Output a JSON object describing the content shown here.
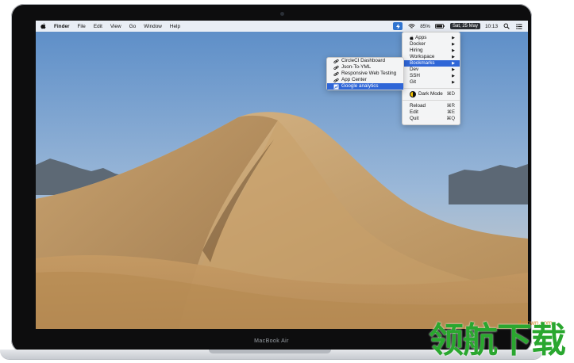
{
  "menubar": {
    "items": [
      {
        "label": "Finder",
        "bold": true
      },
      {
        "label": "File"
      },
      {
        "label": "Edit"
      },
      {
        "label": "View"
      },
      {
        "label": "Go"
      },
      {
        "label": "Window"
      },
      {
        "label": "Help"
      }
    ],
    "battery": "85%",
    "date": "Sat, 25 May",
    "time": "10:13"
  },
  "menu": {
    "items": [
      {
        "label": "Apps",
        "submenu": true
      },
      {
        "label": "Docker",
        "submenu": true
      },
      {
        "label": "Hiring",
        "submenu": true
      },
      {
        "label": "Workspace",
        "submenu": true
      },
      {
        "label": "Bookmarks",
        "submenu": true,
        "selected": true
      },
      {
        "label": "Dev",
        "submenu": true
      },
      {
        "label": "SSH",
        "submenu": true
      },
      {
        "label": "Git",
        "submenu": true
      }
    ],
    "dark_mode": {
      "label": "Dark Mode",
      "shortcut": "⌘D"
    },
    "bottom": [
      {
        "label": "Reload",
        "shortcut": "⌘R"
      },
      {
        "label": "Edit",
        "shortcut": "⌘E"
      },
      {
        "label": "Quit",
        "shortcut": "⌘Q"
      }
    ]
  },
  "submenu": {
    "items": [
      {
        "label": "CircleCI Dashboard"
      },
      {
        "label": "Json-To-YML"
      },
      {
        "label": "Responsive Web Testing"
      },
      {
        "label": "App Center"
      },
      {
        "label": "Google analytics",
        "selected": true
      }
    ]
  },
  "device_label": "MacBook Air",
  "watermark": {
    "url": "lhdown.com",
    "text": "领航下载"
  },
  "colors": {
    "accent": "#2f66d7",
    "watermark_green": "#2aa72f",
    "watermark_orange": "#d58b2a"
  }
}
